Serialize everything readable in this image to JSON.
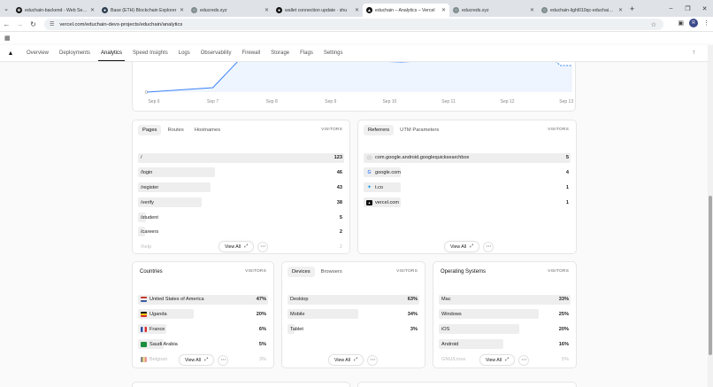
{
  "browser": {
    "tabs": [
      {
        "title": "educhain-backend - Web Servi…",
        "color": "#111111",
        "glyph": "❀",
        "active": false
      },
      {
        "title": "Base (ETH) Blockchain Explorer",
        "color": "#2c3e50",
        "glyph": "●",
        "active": false
      },
      {
        "title": "educreds.xyz",
        "color": "#7f8c8d",
        "glyph": "○",
        "active": false
      },
      {
        "title": "wallet connection update · shu",
        "color": "#111111",
        "glyph": "●",
        "active": false
      },
      {
        "title": "educhain – Analytics – Vercel",
        "color": "#111111",
        "glyph": "▲",
        "active": true
      },
      {
        "title": "educreds.xyz",
        "color": "#7f8c8d",
        "glyph": "○",
        "active": false
      },
      {
        "title": "educhain-lighl010qc-educhain-…",
        "color": "#7f8c8d",
        "glyph": "○",
        "active": false
      }
    ],
    "url": "vercel.com/educhain-devs-projects/educhain/analytics",
    "avatar_letter": "R"
  },
  "nav": {
    "items": [
      "Overview",
      "Deployments",
      "Analytics",
      "Speed Insights",
      "Logs",
      "Observability",
      "Firewall",
      "Storage",
      "Flags",
      "Settings"
    ],
    "active": "Analytics"
  },
  "chart": {
    "y_zero_label": "0",
    "x_labels": [
      "Sep 6",
      "Sep 7",
      "Sep 8",
      "Sep 9",
      "Sep 10",
      "Sep 11",
      "Sep 12",
      "Sep 13"
    ],
    "line_color": "#3b82f6",
    "area_color": "#eef5ff"
  },
  "pages_card": {
    "tabs": [
      "Pages",
      "Routes",
      "Hostnames"
    ],
    "metric": "VISITORS",
    "rows": [
      {
        "label": "/",
        "value": "123",
        "pct": 1.0
      },
      {
        "label": "/login",
        "value": "46",
        "pct": 0.374
      },
      {
        "label": "/register",
        "value": "43",
        "pct": 0.35
      },
      {
        "label": "/verify",
        "value": "38",
        "pct": 0.309
      },
      {
        "label": "/student",
        "value": "5",
        "pct": 0.04
      },
      {
        "label": "/careers",
        "value": "2",
        "pct": 0.016
      },
      {
        "label": "/help",
        "value": "2",
        "pct": 0.016,
        "fade": true
      }
    ],
    "view_all": "View All"
  },
  "referrers_card": {
    "tabs": [
      "Referrers",
      "UTM Parameters"
    ],
    "metric": "VISITORS",
    "rows": [
      {
        "label": "com.google.android.googlequicksearchbox",
        "value": "5",
        "pct": 1.0,
        "icon": "ico-gapp",
        "glyph": ""
      },
      {
        "label": "google.com",
        "value": "4",
        "pct": 0.18,
        "icon": "ico-g",
        "glyph": "G"
      },
      {
        "label": "t.co",
        "value": "1",
        "pct": 0.18,
        "icon": "ico-tw",
        "glyph": "✦"
      },
      {
        "label": "vercel.com",
        "value": "1",
        "pct": 0.18,
        "icon": "ico-v",
        "glyph": "▲"
      }
    ],
    "view_all": "View All"
  },
  "countries_card": {
    "title": "Countries",
    "metric": "VISITORS",
    "rows": [
      {
        "label": "United States of America",
        "value": "47%",
        "pct": 1.0,
        "icon": "flag-us"
      },
      {
        "label": "Uganda",
        "value": "20%",
        "pct": 0.43,
        "icon": "flag-ug"
      },
      {
        "label": "France",
        "value": "6%",
        "pct": 0.22,
        "icon": "flag-fr"
      },
      {
        "label": "Saudi Arabia",
        "value": "5%",
        "pct": 0.2,
        "icon": "flag-sa"
      },
      {
        "label": "Belgium",
        "value": "3%",
        "pct": 0.15,
        "icon": "flag-be",
        "fade": true
      }
    ],
    "view_all": "View All"
  },
  "devices_card": {
    "tabs": [
      "Devices",
      "Browsers"
    ],
    "metric": "VISITORS",
    "rows": [
      {
        "label": "Desktop",
        "value": "63%",
        "pct": 1.0
      },
      {
        "label": "Mobile",
        "value": "34%",
        "pct": 0.54
      },
      {
        "label": "Tablet",
        "value": "3%",
        "pct": 0.05
      }
    ],
    "view_all": "View All"
  },
  "os_card": {
    "title": "Operating Systems",
    "metric": "VISITORS",
    "rows": [
      {
        "label": "Mac",
        "value": "33%",
        "pct": 1.0
      },
      {
        "label": "Windows",
        "value": "25%",
        "pct": 0.76
      },
      {
        "label": "iOS",
        "value": "20%",
        "pct": 0.61
      },
      {
        "label": "Android",
        "value": "16%",
        "pct": 0.49
      },
      {
        "label": "GNU/Linux",
        "value": "5%",
        "pct": 0.15,
        "fade": true
      }
    ],
    "view_all": "View All"
  }
}
